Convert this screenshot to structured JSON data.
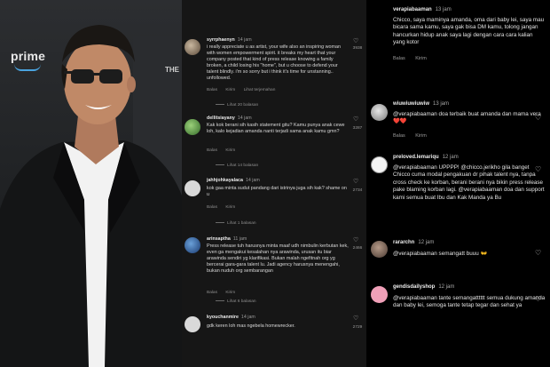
{
  "photo": {
    "prime_logo": "prime",
    "the_text": "THE"
  },
  "middle": {
    "reply_label": "Balas",
    "send_label": "Kirim",
    "comments": [
      {
        "user": "syrrphaenyn",
        "time": "14 jam",
        "text": "i really appreciate u as artist, your wife also an inspiring woman with women empowerment spirit. it breaks my heart that your company posted that kind of press release knowing a family broken, a child losing his \"home\", but u choose to defend your talent blindly. i'm so sorry but i think it's time for unstanning.. unfollowed.",
        "likes": "3938",
        "extra": "Lihat terjemahan",
        "view_replies": "Lihat 20 balasan"
      },
      {
        "user": "dellitsiayany",
        "time": "14 jam",
        "text": "Kak kok berani sih kasih statement gitu? Kamu punya anak cewe loh, kalo kejadian amanda nanti terjadi sama anak kamu gmn?",
        "likes": "3287",
        "view_replies": "Lihat 14 balasan"
      },
      {
        "user": "jahhjohkayalaca",
        "time": "14 jam",
        "text": "kok gaa minta sudut pandang dari istrinya juga sih kak? shame on u",
        "likes": "2734",
        "view_replies": "Lihat 1 balasan"
      },
      {
        "user": "arinsaptha",
        "time": "11 jam",
        "text": "Press release tuh harusnya minta maaf udh nimbulin kerbutan kek, even ga mengakui kesalahan nya arawinda, urusan itu biar arawinda sendiri yg klarifikasi. Bukan malah ngefitnah org yg bercerai gara-gara talent lu. Jadi agency harusnya menengahi, bukan nuduh org sembarangan",
        "likes": "2466",
        "view_replies": "Lihat 6 balasan"
      },
      {
        "user": "kyouchanmire",
        "time": "14 jam",
        "text": "gdk keren loh mas ngebela homewrecker.",
        "likes": "2729"
      }
    ]
  },
  "right": {
    "reply_label": "Balas",
    "send_label": "Kirim",
    "comments": [
      {
        "user": "verapiabaaman",
        "time": "13 jam",
        "text": "Chicco, saya maminya amanda, oma dari baby lei, saya mau bicara sama kamu, saya gak bisa DM kamu, tolong jangan hancurkan hidup anak saya lagi dengan cara cara kalian yang kotor"
      },
      {
        "user": "wiuwiuwiuwiw",
        "time": "13 jam",
        "text": "@verapiabaaman doa terbaik buat amanda dan mama vera",
        "emoji": "❤️❤️"
      },
      {
        "user": "preloved.lemariqu",
        "time": "12 jam",
        "text": "@verapiabaaman UPPPP! @chicco.jerikho gila banget Chicco cuma modal pengakuan dr pihak talent nya, tanpa cross check ke korban, berani berani nya bikin press release pake blaming korban lagi. @verapiabaaman doa dan support kami semua buat Ibu dan Kak Manda ya Bu"
      },
      {
        "user": "rararchn",
        "time": "12 jam",
        "text": "@verapiabaaman semangatt buuu",
        "emoji": "👐"
      },
      {
        "user": "gendisdailyshop",
        "time": "12 jam",
        "text": "@verapiabaaman tante semangatttttt semua dukung amanda dan baby lei, semoga tante tetap tegar dan sehat ya"
      }
    ]
  },
  "colors": {
    "middle_bg": "#161616",
    "right_bg": "#000000",
    "heart_red": "#e1343c"
  }
}
